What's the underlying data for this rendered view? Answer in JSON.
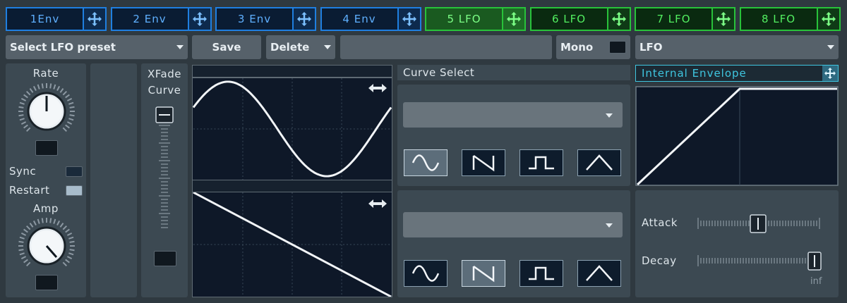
{
  "tabs": [
    {
      "label": "1Env",
      "kind": "env"
    },
    {
      "label": "2 Env",
      "kind": "env"
    },
    {
      "label": "3 Env",
      "kind": "env"
    },
    {
      "label": "4 Env",
      "kind": "env"
    },
    {
      "label": "5 LFO",
      "kind": "lfo",
      "active": true
    },
    {
      "label": "6 LFO",
      "kind": "lfo"
    },
    {
      "label": "7 LFO",
      "kind": "lfo"
    },
    {
      "label": "8 LFO",
      "kind": "lfo"
    }
  ],
  "toolbar": {
    "preset_label": "Select LFO preset",
    "save_label": "Save",
    "delete_label": "Delete",
    "preset_name": "",
    "mono_label": "Mono",
    "mode_label": "LFO"
  },
  "left": {
    "rate_label": "Rate",
    "sync_label": "Sync",
    "restart_label": "Restart",
    "amp_label": "Amp",
    "xfade_label_1": "XFade",
    "xfade_label_2": "Curve"
  },
  "curves": {
    "title": "Curve Select",
    "top_selected": "sine",
    "bottom_selected": "saw",
    "shapes": [
      "sine",
      "saw",
      "square",
      "triangle"
    ]
  },
  "envelope": {
    "title": "Internal Envelope",
    "attack_label": "Attack",
    "decay_label": "Decay",
    "decay_value": "inf",
    "attack_level": 0.5,
    "decay_level": 1.0
  },
  "colors": {
    "env_accent": "#1f7fe0",
    "lfo_accent": "#28c23a",
    "envelope_title": "#3fc6e0"
  }
}
